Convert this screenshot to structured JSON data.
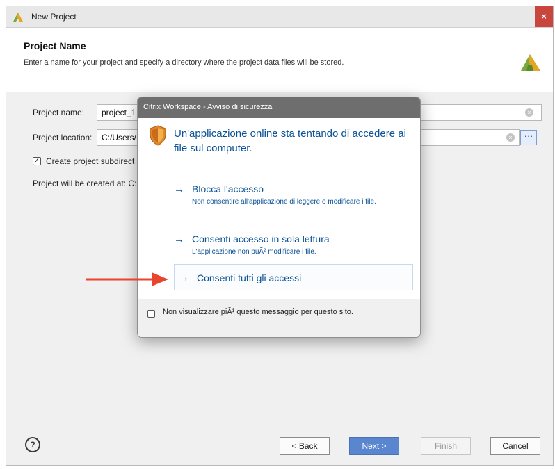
{
  "window": {
    "title": "New Project",
    "close": "×"
  },
  "header": {
    "title": "Project Name",
    "subtitle": "Enter a name for your project and specify a directory where the project data files will be stored."
  },
  "form": {
    "project_name_label": "Project name:",
    "project_name_value": "project_1",
    "project_location_label": "Project location:",
    "project_location_value": "C:/Users/",
    "create_subdir_label": "Create project subdirect",
    "create_subdir_checked": "✓",
    "created_at_label": "Project will be created at: C:",
    "browse_label": "···"
  },
  "footer": {
    "help_label": "?",
    "back_label": "< Back",
    "next_label": "Next >",
    "finish_label": "Finish",
    "cancel_label": "Cancel"
  },
  "dialog": {
    "title": "Citrix Workspace - Avviso di sicurezza",
    "message": "Un'applicazione online sta tentando di accedere ai file sul computer.",
    "options": [
      {
        "arrow": "→",
        "title": "Blocca l'accesso",
        "description": "Non consentire all'applicazione di leggere o modificare i file."
      },
      {
        "arrow": "→",
        "title": "Consenti accesso in sola lettura",
        "description": "L'applicazione non puÃ² modificare i file."
      },
      {
        "arrow": "→",
        "title": "Consenti tutti gli accessi"
      }
    ],
    "dont_show_label": "Non visualizzare piÃ¹ questo messaggio per questo sito."
  },
  "colors": {
    "dialog_link": "#0a5196",
    "annotation_arrow": "#e8442e",
    "next_button": "#5a86cf"
  }
}
